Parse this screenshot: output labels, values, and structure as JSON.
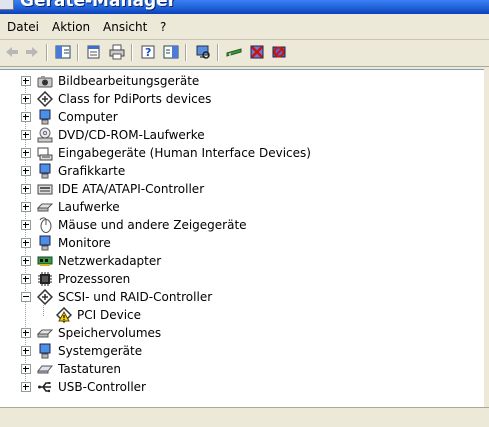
{
  "window": {
    "title": "Geräte-Manager"
  },
  "menu": [
    "Datei",
    "Aktion",
    "Ansicht",
    "?"
  ],
  "toolbar": {
    "buttons": [
      {
        "icon": "back-arrow-icon"
      },
      {
        "icon": "forward-arrow-icon"
      },
      {
        "icon": "show-hide-console-tree-icon"
      },
      {
        "icon": "properties-icon"
      },
      {
        "icon": "print-icon"
      },
      {
        "icon": "help-icon"
      },
      {
        "icon": "show-hide-action-pane-icon"
      },
      {
        "icon": "scan-hardware-changes-icon"
      },
      {
        "icon": "update-driver-icon"
      },
      {
        "icon": "disable-device-icon"
      },
      {
        "icon": "uninstall-device-icon"
      }
    ]
  },
  "tree": {
    "items": [
      {
        "label": "Bildbearbeitungsgeräte",
        "icon": "camera-icon",
        "expanded": false
      },
      {
        "label": "Class for PdiPorts devices",
        "icon": "port-connector-icon",
        "expanded": false
      },
      {
        "label": "Computer",
        "icon": "computer-icon",
        "expanded": false
      },
      {
        "label": "DVD/CD-ROM-Laufwerke",
        "icon": "cd-drive-icon",
        "expanded": false
      },
      {
        "label": "Eingabegeräte (Human Interface Devices)",
        "icon": "hid-keyboard-icon",
        "expanded": false
      },
      {
        "label": "Grafikkarte",
        "icon": "monitor-icon",
        "expanded": false
      },
      {
        "label": "IDE ATA/ATAPI-Controller",
        "icon": "ide-controller-icon",
        "expanded": false
      },
      {
        "label": "Laufwerke",
        "icon": "disk-drive-icon",
        "expanded": false
      },
      {
        "label": "Mäuse und andere Zeigegeräte",
        "icon": "mouse-icon",
        "expanded": false
      },
      {
        "label": "Monitore",
        "icon": "monitor-icon",
        "expanded": false
      },
      {
        "label": "Netzwerkadapter",
        "icon": "network-adapter-icon",
        "expanded": false
      },
      {
        "label": "Prozessoren",
        "icon": "processor-icon",
        "expanded": false
      },
      {
        "label": "SCSI- und RAID-Controller",
        "icon": "scsi-controller-icon",
        "expanded": true
      },
      {
        "label": "PCI Device",
        "icon": "warning-device-icon",
        "child": true
      },
      {
        "label": "Speichervolumes",
        "icon": "disk-drive-icon",
        "expanded": false
      },
      {
        "label": "Systemgeräte",
        "icon": "computer-icon",
        "expanded": false
      },
      {
        "label": "Tastaturen",
        "icon": "keyboard-icon",
        "expanded": false
      },
      {
        "label": "USB-Controller",
        "icon": "usb-icon",
        "expanded": false
      }
    ]
  }
}
